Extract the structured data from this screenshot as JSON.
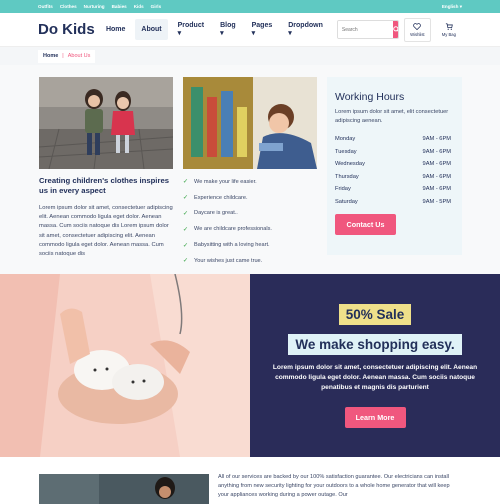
{
  "topbar": {
    "links": [
      "Outfits",
      "Clothes",
      "Nurturing",
      "Babies",
      "Kids",
      "Girls"
    ],
    "language": "English ▾"
  },
  "header": {
    "logo": "Do Kids",
    "menu": [
      {
        "label": "Home"
      },
      {
        "label": "About"
      },
      {
        "label": "Product ▾"
      },
      {
        "label": "Blog ▾"
      },
      {
        "label": "Pages ▾"
      },
      {
        "label": "Dropdown ▾"
      }
    ],
    "search_placeholder": "Search",
    "wishlist_label": "Wishlist",
    "bag_label": "My Bag"
  },
  "breadcrumb": {
    "home": "Home",
    "separator": "|",
    "current": "About Us"
  },
  "about": {
    "heading": "Creating children's clothes inspires us in every aspect",
    "paragraph": "Lorem ipsum dolor sit amet, consectetuer adipiscing elit. Aenean commodo ligula eget dolor. Aenean massa. Cum sociis natoque dis Lorem ipsum dolor sit amet, consectetuer adipiscing elit. Aenean commodo ligula eget dolor. Aenean massa. Cum sociis natoque dis",
    "checklist": [
      "We make your life easier.",
      "Experience childcare.",
      "Daycare is great..",
      "We are childcare professionals.",
      "Babysitting with a loving heart.",
      "Your wishes just came true."
    ]
  },
  "hours": {
    "title": "Working Hours",
    "description": "Lorem ipsum dolor sit amet, elit consectetuer adipiscing aenean.",
    "rows": [
      {
        "day": "Monday",
        "time": "9AM - 6PM"
      },
      {
        "day": "Tuesday",
        "time": "9AM - 6PM"
      },
      {
        "day": "Wednesday",
        "time": "9AM - 6PM"
      },
      {
        "day": "Thursday",
        "time": "9AM - 6PM"
      },
      {
        "day": "Friday",
        "time": "9AM - 6PM"
      },
      {
        "day": "Saturday",
        "time": "9AM - 5PM"
      }
    ],
    "button": "Contact Us"
  },
  "banner": {
    "sale": "50% Sale",
    "headline": "We make shopping easy.",
    "description": "Lorem ipsum dolor sit amet, consectetuer adipiscing elit. Aenean commodo ligula eget dolor. Aenean massa. Cum sociis natoque penatibus et magnis dis parturient",
    "button": "Learn More"
  },
  "bottom": {
    "text": "All of our services are backed by our 100% satisfaction guarantee. Our electricians can install anything from new security lighting for your outdoors to a whole home generator that will keep your appliances working during a power outage. Our"
  },
  "colors": {
    "accent": "#f0577e",
    "topbar": "#5fc9c2",
    "navy": "#2a2c59",
    "sale": "#efe08a"
  }
}
